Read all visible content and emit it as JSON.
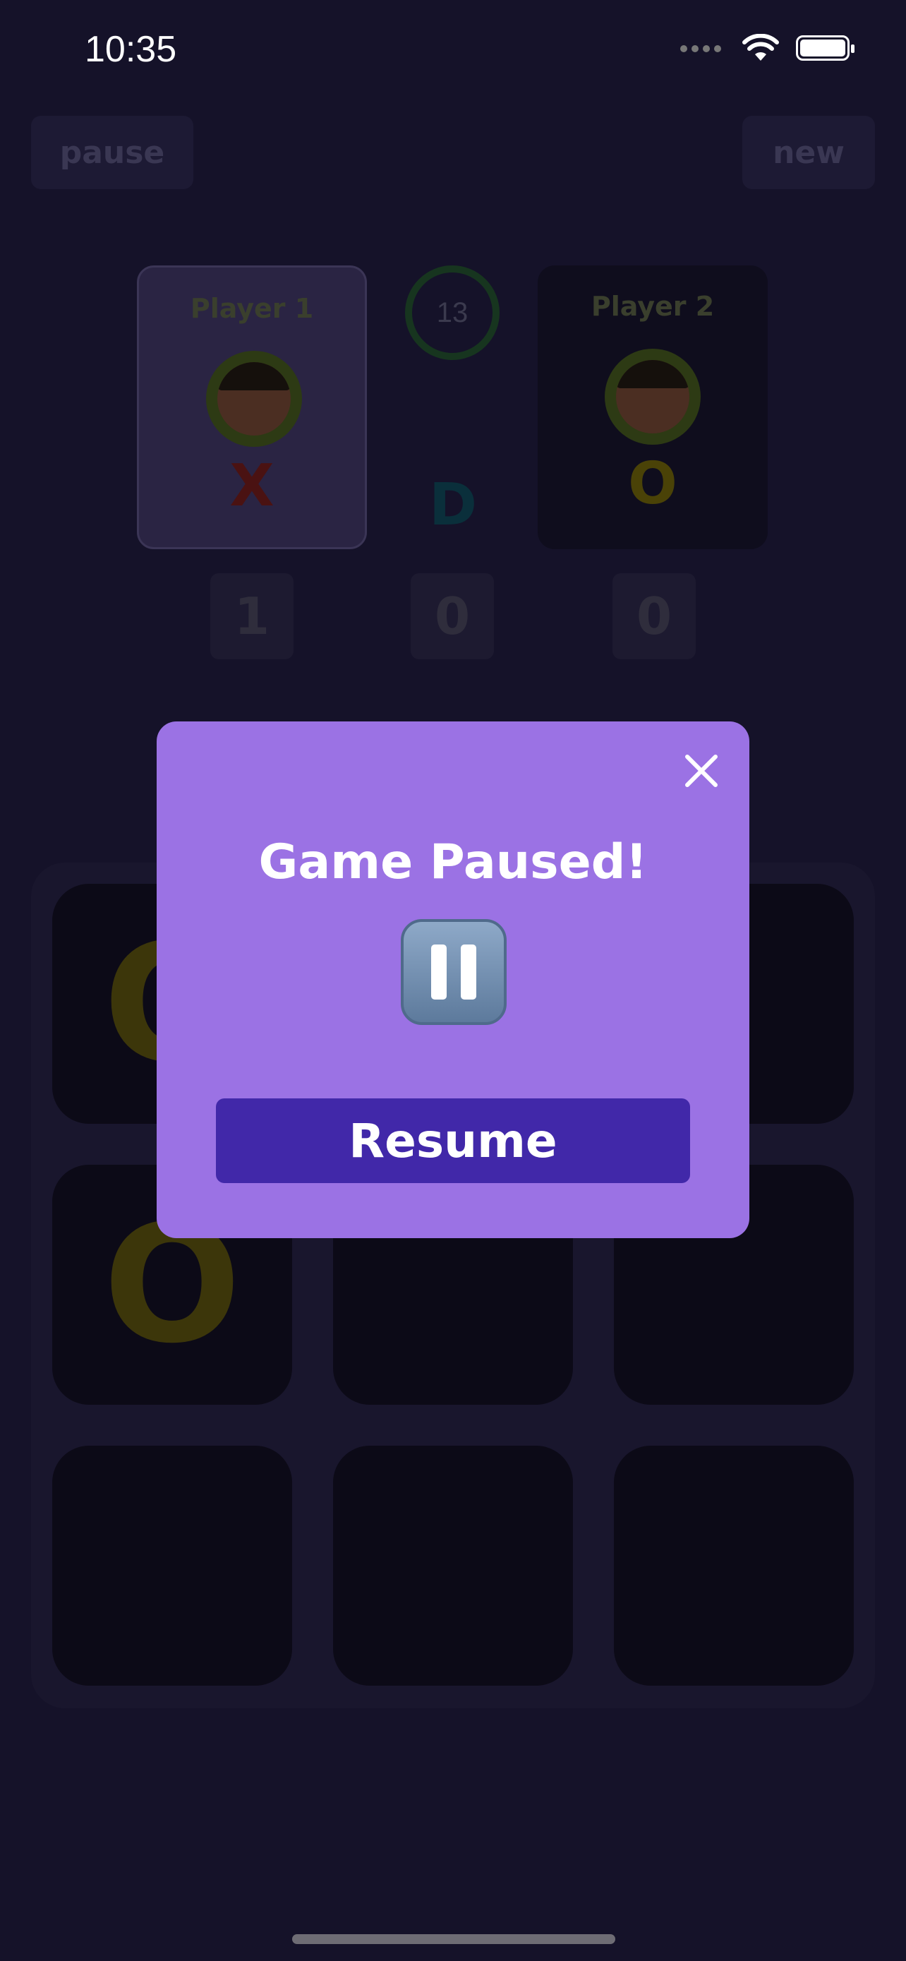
{
  "status_bar": {
    "time": "10:35"
  },
  "toolbar": {
    "pause_label": "pause",
    "new_label": "new"
  },
  "players": [
    {
      "name": "Player 1",
      "symbol": "X"
    },
    {
      "name": "Player 2",
      "symbol": "O"
    }
  ],
  "timer": {
    "value": "13"
  },
  "draw": {
    "symbol": "D"
  },
  "scores": {
    "player1": "1",
    "draw": "0",
    "player2": "0"
  },
  "board": {
    "cells": [
      "O",
      "",
      "",
      "O",
      "",
      "",
      "",
      "",
      ""
    ]
  },
  "modal": {
    "title": "Game Paused!",
    "icon": "pause-button-emoji",
    "resume_label": "Resume"
  },
  "colors": {
    "modal_bg": "#9b72e4",
    "resume_bg": "#4128a9",
    "app_bg": "#151229"
  }
}
